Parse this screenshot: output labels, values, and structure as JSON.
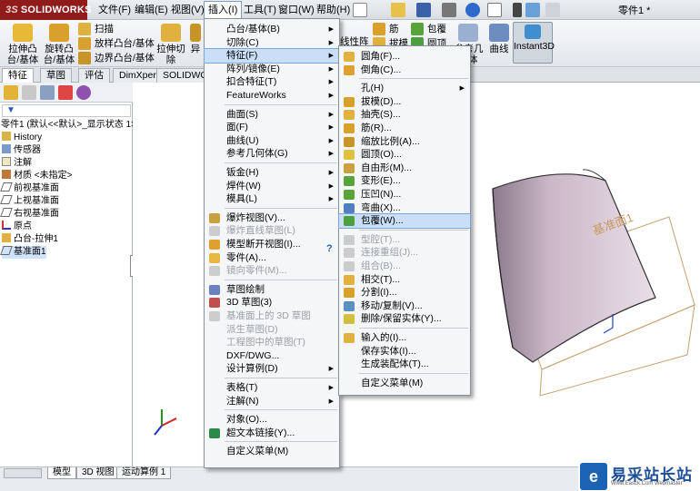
{
  "app": {
    "logo_prefix": "3S",
    "logo": "SOLIDWORKS",
    "doc_title": "零件1 *"
  },
  "menubar": [
    "文件(F)",
    "编辑(E)",
    "视图(V)",
    "插入(I)",
    "工具(T)",
    "窗口(W)",
    "帮助(H)"
  ],
  "ribbon": {
    "extrude": "拉伸凸\n台/基体",
    "revolve": "旋转凸\n台/基体",
    "sweep": "扫描",
    "loft": "放样凸台/基体",
    "boundary": "边界凸台/基体",
    "extrude_cut": "拉伸切\n除",
    "other_cut": "异",
    "linear_pattern": "线性阵",
    "rib": "筋",
    "wrap": "包覆",
    "draft": "拔模",
    "dome": "圆顶",
    "ref_geom": "参考几\n何体",
    "curves": "曲线",
    "instant3d": "Instant3D"
  },
  "cmd_tabs": [
    "特征",
    "草图",
    "评估",
    "DimXpert",
    "SOLIDWO"
  ],
  "feature_tree": {
    "filter_icon": "funnel-icon",
    "root": "零件1 (默认<<默认>_显示状态 1>)",
    "items": [
      "History",
      "传感器",
      "注解",
      "材质 <未指定>",
      "前视基准面",
      "上视基准面",
      "右视基准面",
      "原点",
      "凸台-拉伸1",
      "基准面1"
    ]
  },
  "insert_menu": {
    "groups": [
      [
        "凸台/基体(B)",
        "切除(C)",
        "特征(F)",
        "阵列/镜像(E)",
        "扣合特征(T)",
        "FeatureWorks"
      ],
      [
        "曲面(S)",
        "面(F)",
        "曲线(U)",
        "参考几何体(G)"
      ],
      [
        "钣金(H)",
        "焊件(W)",
        "模具(L)"
      ],
      [
        "爆炸视图(V)...",
        "爆炸直线草图(L)",
        "模型断开视图(I)...",
        "零件(A)...",
        "镜向零件(M)..."
      ],
      [
        "草图绘制",
        "3D 草图(3)",
        "基准面上的 3D 草图",
        "派生草图(D)",
        "工程图中的草图(T)",
        "DXF/DWG...",
        "设计算例(D)"
      ],
      [
        "表格(T)",
        "注解(N)"
      ],
      [
        "对象(O)...",
        "超文本链接(Y)..."
      ],
      [
        "自定义菜单(M)"
      ]
    ]
  },
  "feature_submenu": {
    "groups": [
      [
        "圆角(F)...",
        "倒角(C)..."
      ],
      [
        "孔(H)",
        "拔模(D)...",
        "抽壳(S)...",
        "筋(R)...",
        "缩放比例(A)...",
        "圆顶(O)...",
        "自由形(M)...",
        "变形(E)...",
        "压凹(N)...",
        "弯曲(X)...",
        "包覆(W)..."
      ],
      [
        "型腔(T)...",
        "连接重组(J)...",
        "组合(B)...",
        "相交(T)...",
        "分割(I)...",
        "移动/复制(V)...",
        "删除/保留实体(Y)..."
      ],
      [
        "输入的(I)...",
        "保存实体(I)...",
        "生成装配体(T)..."
      ],
      [
        "自定义菜单(M)"
      ]
    ]
  },
  "viewport": {
    "plane_label": "基准面1"
  },
  "bottom_tabs": [
    "模型",
    "3D 视图",
    "运动算例 1"
  ],
  "watermark": {
    "logo": "e",
    "text": "易采站长站",
    "sub": "Www.Easck.Com Webmaster"
  },
  "colors": {
    "accent": "#1d63b3",
    "highlight": "#c9dff7",
    "plane": "#c8a070",
    "body": "#c9b3c6"
  }
}
